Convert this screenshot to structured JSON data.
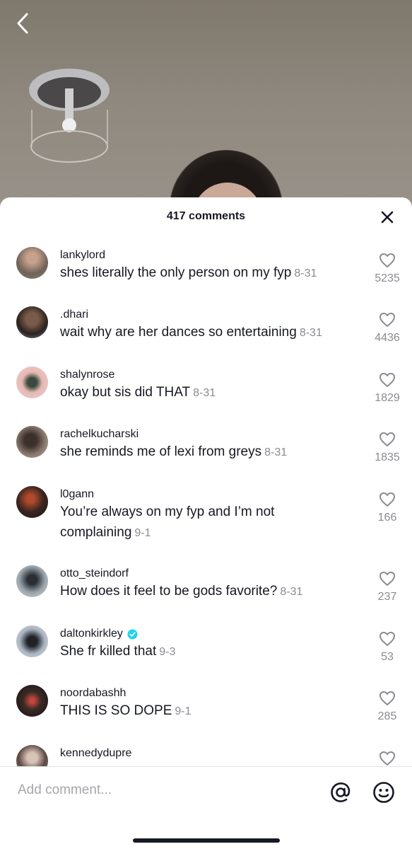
{
  "header": {
    "title": "417 comments"
  },
  "comments": [
    {
      "username": "lankylord",
      "text": "shes literally the only person on my fyp",
      "date": "8-31",
      "likes": "5235",
      "verified": false,
      "avatar_color": "#8a7d72"
    },
    {
      "username": ".dhari",
      "text": "wait why are her dances so entertaining",
      "date": "8-31",
      "likes": "4436",
      "verified": false,
      "avatar_color": "#3a2a24"
    },
    {
      "username": "shalynrose",
      "text": "okay but sis did THAT",
      "date": "8-31",
      "likes": "1829",
      "verified": false,
      "avatar_color": "#d9a7a4"
    },
    {
      "username": "rachelkucharski",
      "text": "she reminds me of lexi from greys",
      "date": "8-31",
      "likes": "1835",
      "verified": false,
      "avatar_color": "#6e5a4d"
    },
    {
      "username": "l0gann",
      "text": "You’re always on my fyp and I’m not complaining",
      "date": "9-1",
      "likes": "166",
      "verified": false,
      "avatar_color": "#3b2620"
    },
    {
      "username": "otto_steindorf",
      "text": "How does it feel to be gods favorite?",
      "date": "8-31",
      "likes": "237",
      "verified": false,
      "avatar_color": "#b9c0c6"
    },
    {
      "username": "daltonkirkley",
      "text": "She fr killed that",
      "date": "9-3",
      "likes": "53",
      "verified": true,
      "avatar_color": "#c7ccd6"
    },
    {
      "username": "noordabashh",
      "text": "THIS IS SO DOPE",
      "date": "9-1",
      "likes": "285",
      "verified": false,
      "avatar_color": "#241c1a"
    },
    {
      "username": "kennedydupre",
      "text": "",
      "date": "",
      "likes": "",
      "verified": false,
      "avatar_color": "#9a8c84"
    }
  ],
  "composer": {
    "placeholder": "Add comment..."
  },
  "colors": {
    "verified_badge": "#20d5ec",
    "text": "#161823",
    "muted": "#8a8b91"
  }
}
